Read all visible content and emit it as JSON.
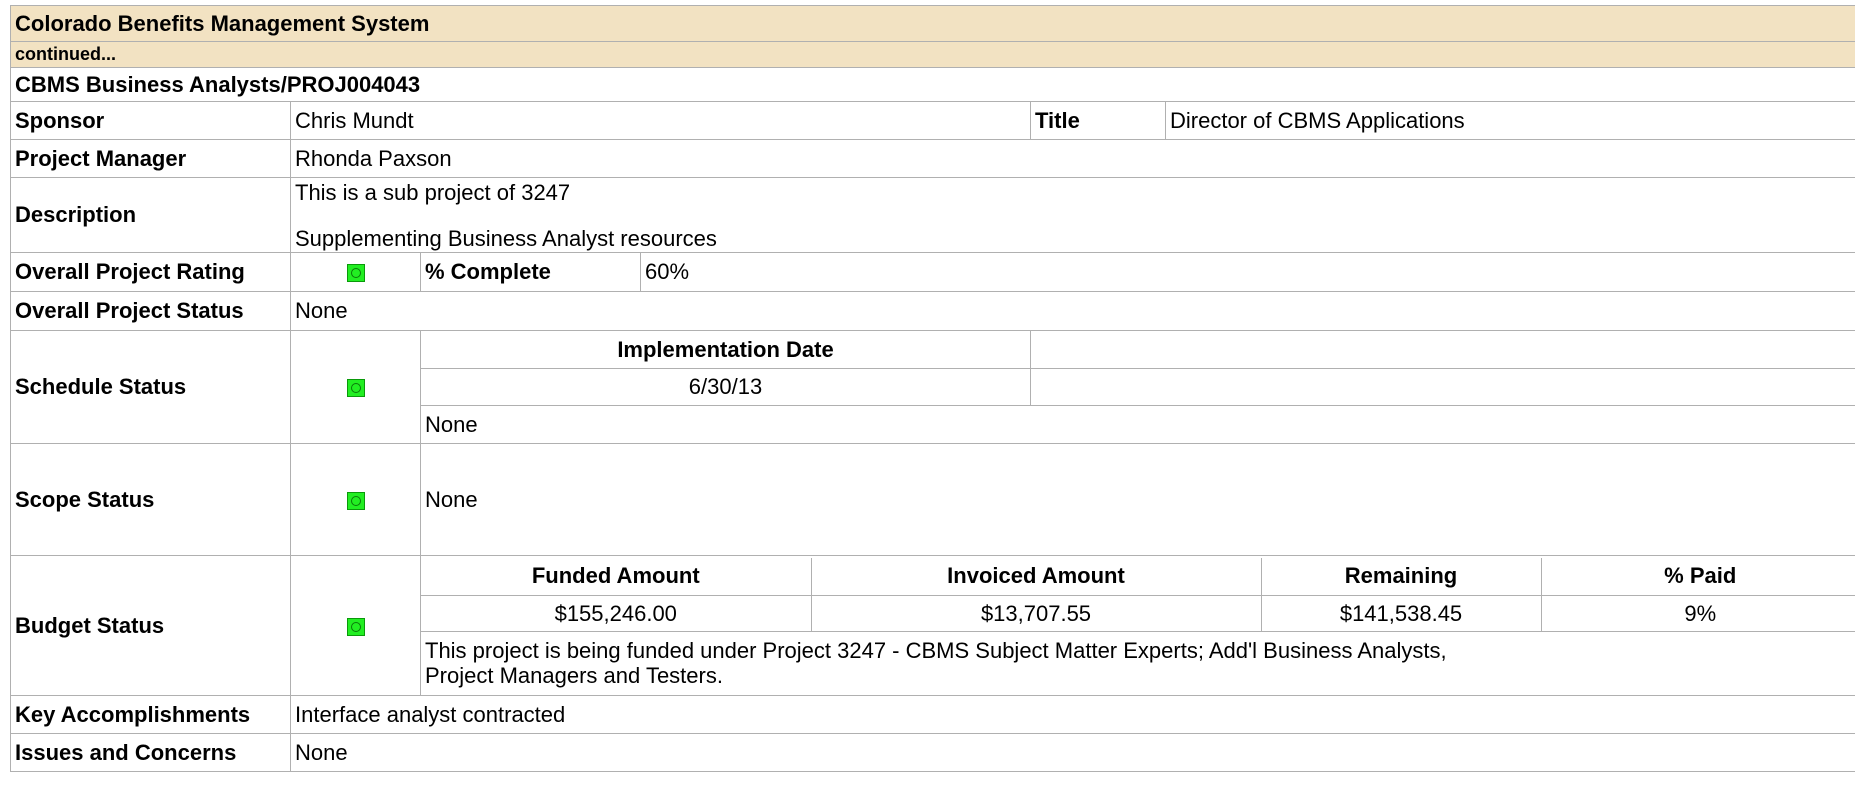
{
  "header": {
    "system_title": "Colorado Benefits Management System",
    "continued": "continued..."
  },
  "project": {
    "name": "CBMS Business Analysts/PROJ004043",
    "sponsor_label": "Sponsor",
    "sponsor": "Chris Mundt",
    "title_label": "Title",
    "title": "Director of CBMS Applications",
    "pm_label": "Project Manager",
    "pm": "Rhonda Paxson",
    "description_label": "Description",
    "description_line1": "This is a sub project of 3247",
    "description_line2": "Supplementing Business Analyst resources",
    "rating_label": "Overall Project Rating",
    "rating_status": "green",
    "complete_label": "% Complete",
    "complete": "60%",
    "status_label": "Overall Project Status",
    "status": "None"
  },
  "schedule": {
    "label": "Schedule Status",
    "status": "green",
    "impl_date_label": "Implementation Date",
    "impl_date": "6/30/13",
    "note": "None"
  },
  "scope": {
    "label": "Scope Status",
    "status": "green",
    "note": "None"
  },
  "budget": {
    "label": "Budget Status",
    "status": "green",
    "headers": [
      "Funded Amount",
      "Invoiced Amount",
      "Remaining",
      "% Paid"
    ],
    "values": [
      "$155,246.00",
      "$13,707.55",
      "$141,538.45",
      "9%"
    ],
    "note_line1": "This project is being funded under Project 3247 - CBMS Subject Matter Experts; Add'l Business Analysts,",
    "note_line2": "Project Managers and Testers."
  },
  "key_accomplishments": {
    "label": "Key Accomplishments",
    "value": "Interface analyst contracted"
  },
  "issues": {
    "label": "Issues and Concerns",
    "value": "None"
  },
  "colors": {
    "header_bg": "#f2e2c2",
    "status_green": "#22ee22"
  }
}
